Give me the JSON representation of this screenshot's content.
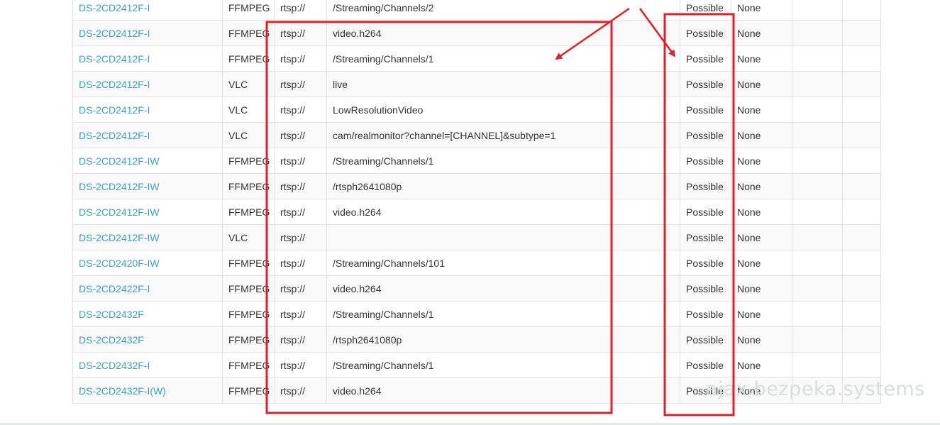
{
  "rows": [
    {
      "model": "DS-2CD2412F-I",
      "client": "FFMPEG",
      "protocol": "rtsp://",
      "path": "/Streaming/Channels/2",
      "status": "Possible",
      "auth": "None"
    },
    {
      "model": "DS-2CD2412F-I",
      "client": "FFMPEG",
      "protocol": "rtsp://",
      "path": "video.h264",
      "status": "Possible",
      "auth": "None"
    },
    {
      "model": "DS-2CD2412F-I",
      "client": "FFMPEG",
      "protocol": "rtsp://",
      "path": "/Streaming/Channels/1",
      "status": "Possible",
      "auth": "None"
    },
    {
      "model": "DS-2CD2412F-I",
      "client": "VLC",
      "protocol": "rtsp://",
      "path": "live",
      "status": "Possible",
      "auth": "None"
    },
    {
      "model": "DS-2CD2412F-I",
      "client": "VLC",
      "protocol": "rtsp://",
      "path": "LowResolutionVideo",
      "status": "Possible",
      "auth": "None"
    },
    {
      "model": "DS-2CD2412F-I",
      "client": "VLC",
      "protocol": "rtsp://",
      "path": "cam/realmonitor?channel=[CHANNEL]&subtype=1",
      "status": "Possible",
      "auth": "None"
    },
    {
      "model": "DS-2CD2412F-IW",
      "client": "FFMPEG",
      "protocol": "rtsp://",
      "path": "/Streaming/Channels/1",
      "status": "Possible",
      "auth": "None"
    },
    {
      "model": "DS-2CD2412F-IW",
      "client": "FFMPEG",
      "protocol": "rtsp://",
      "path": "/rtsph2641080p",
      "status": "Possible",
      "auth": "None"
    },
    {
      "model": "DS-2CD2412F-IW",
      "client": "FFMPEG",
      "protocol": "rtsp://",
      "path": "video.h264",
      "status": "Possible",
      "auth": "None"
    },
    {
      "model": "DS-2CD2412F-IW",
      "client": "VLC",
      "protocol": "rtsp://",
      "path": "",
      "status": "Possible",
      "auth": "None"
    },
    {
      "model": "DS-2CD2420F-IW",
      "client": "FFMPEG",
      "protocol": "rtsp://",
      "path": "/Streaming/Channels/101",
      "status": "Possible",
      "auth": "None"
    },
    {
      "model": "DS-2CD2422F-I",
      "client": "FFMPEG",
      "protocol": "rtsp://",
      "path": "video.h264",
      "status": "Possible",
      "auth": "None"
    },
    {
      "model": "DS-2CD2432F",
      "client": "FFMPEG",
      "protocol": "rtsp://",
      "path": "/Streaming/Channels/1",
      "status": "Possible",
      "auth": "None"
    },
    {
      "model": "DS-2CD2432F",
      "client": "FFMPEG",
      "protocol": "rtsp://",
      "path": "/rtsph2641080p",
      "status": "Possible",
      "auth": "None"
    },
    {
      "model": "DS-2CD2432F-I",
      "client": "FFMPEG",
      "protocol": "rtsp://",
      "path": "/Streaming/Channels/1",
      "status": "Possible",
      "auth": "None"
    },
    {
      "model": "DS-2CD2432F-I(W)",
      "client": "FFMPEG",
      "protocol": "rtsp://",
      "path": "video.h264",
      "status": "Possible",
      "auth": "None"
    }
  ],
  "watermark": "ajax.bezpeka.systems",
  "colors": {
    "link": "#3aa0c8",
    "annotation": "#e01f26"
  }
}
